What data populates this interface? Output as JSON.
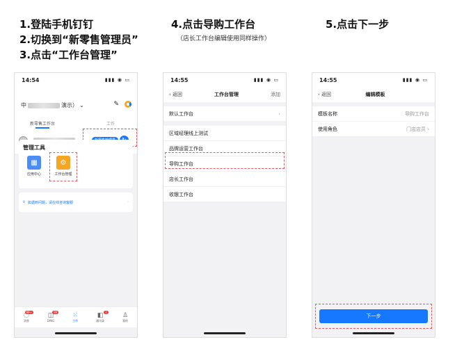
{
  "steps": {
    "s1": "1.登陆手机钉钉",
    "s2": "2.切换到“新零售管理员”",
    "s3": "3.点击“工作台管理”",
    "s4": "4.点击导购工作台",
    "s4_note": "（店长工作台编辑使用同样操作）",
    "s5": "5.点击下一步"
  },
  "phone1": {
    "time": "14:54",
    "org_prefix": "中",
    "org_suffix": "演示）",
    "tab_active": "新零售工作台",
    "tab_other": "工作",
    "role_badge": "新零售管理员",
    "section_title": "管理工具",
    "tool1": "应用中心",
    "tool2": "工作台管理",
    "help_text": "如遇到问题，请在线咨询客服",
    "tabbar": [
      {
        "label": "消息",
        "badge": "99+"
      },
      {
        "label": "DING",
        "badge": "99"
      },
      {
        "label": "工作",
        "badge": ""
      },
      {
        "label": "通讯录",
        "badge": "1"
      },
      {
        "label": "我的",
        "badge": ""
      }
    ]
  },
  "phone2": {
    "time": "14:55",
    "back": "返回",
    "title": "工作台管理",
    "action": "添加",
    "rows": [
      "默认工作台",
      "区域经理线上测试",
      "品牌运营工作台",
      "导购工作台",
      "店长工作台",
      "收银工作台"
    ]
  },
  "phone3": {
    "time": "14:55",
    "back": "返回",
    "title": "编辑模板",
    "name_label": "模板名称",
    "name_value": "导购工作台",
    "role_label": "使用角色",
    "role_value": "门店店员",
    "next": "下一步"
  },
  "colors": {
    "accent": "#1677ff",
    "highlight": "#e0585b"
  }
}
